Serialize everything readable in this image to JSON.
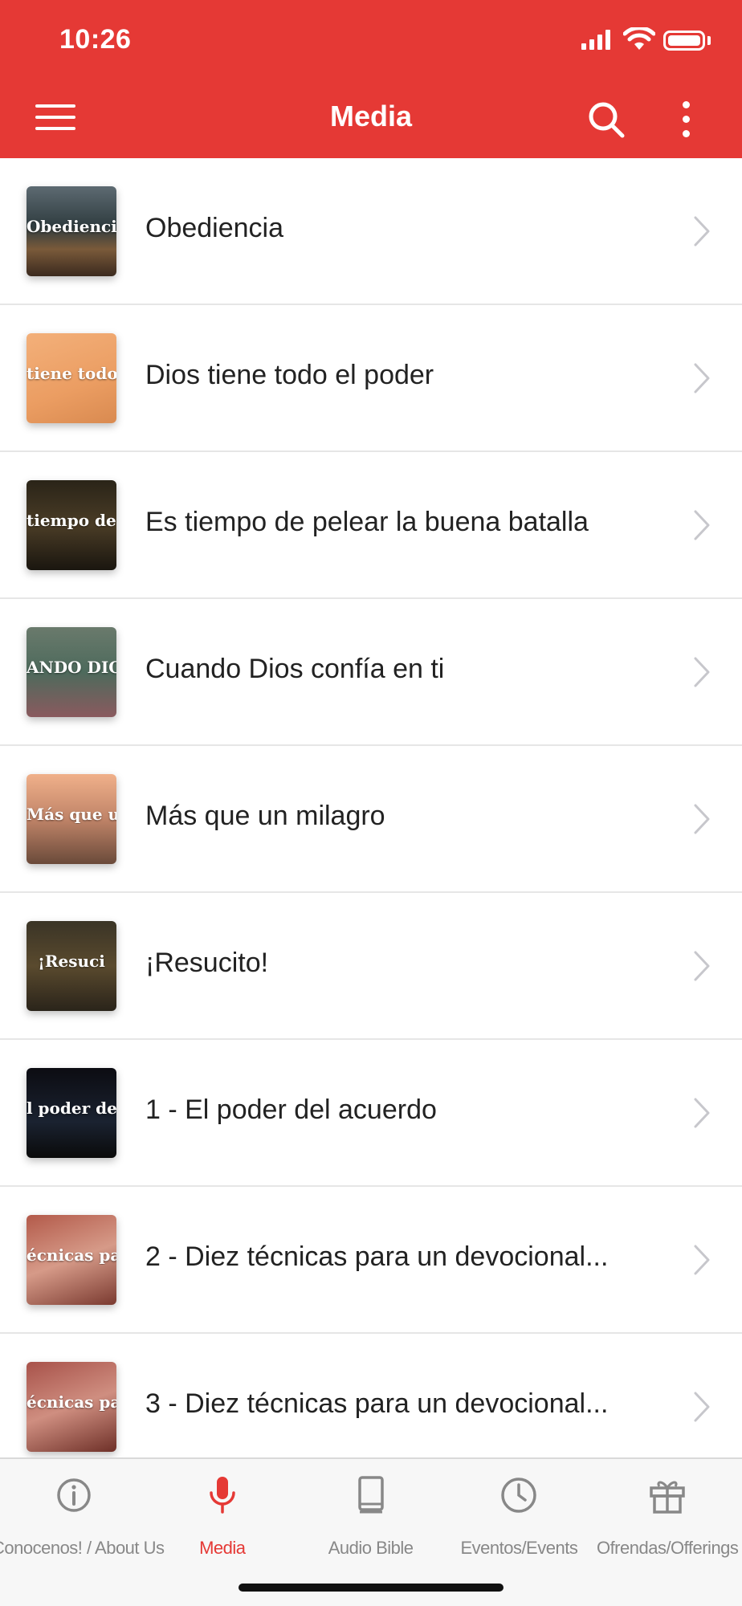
{
  "status_bar": {
    "time": "10:26"
  },
  "header": {
    "title": "Media"
  },
  "colors": {
    "accent": "#e53935",
    "inactive": "#888888"
  },
  "items": [
    {
      "label": "Obediencia",
      "thumb_text": "Obediencia",
      "thumb_bg": "linear-gradient(180deg,#5d6a72 0%,#2f3c3f 45%,#7a5a3a 70%,#3b2a1e 100%)"
    },
    {
      "label": "Dios tiene todo el poder",
      "thumb_text": "tiene todo",
      "thumb_bg": "linear-gradient(160deg,#f3b07a 0%,#eb9d62 60%,#d98a50 100%)"
    },
    {
      "label": "Es tiempo de pelear la buena batalla",
      "thumb_text": "tiempo de pelear",
      "thumb_bg": "linear-gradient(180deg,#2a2418 0%,#4a3c26 50%,#1a160f 100%)"
    },
    {
      "label": "Cuando Dios confía en ti",
      "thumb_text": "ANDO DIOS CONFÍA",
      "thumb_bg": "linear-gradient(180deg,#6a7a6c 0%,#4d6a5c 50%,#8a5a5e 100%)"
    },
    {
      "label": "Más que un milagro",
      "thumb_text": "Más que un milagro",
      "thumb_bg": "linear-gradient(180deg,#f0b08a 0%,#c08468 50%,#6a4a3a 100%)"
    },
    {
      "label": "¡Resucito!",
      "thumb_text": "¡Resuci",
      "thumb_bg": "linear-gradient(180deg,#3a3426 0%,#5a4a2e 50%,#2a241a 100%)"
    },
    {
      "label": "1 - El poder del acuerdo",
      "thumb_text": "l poder del acuerd",
      "thumb_bg": "linear-gradient(180deg,#0c0c12 0%,#1a2230 60%,#0a0a0a 100%)"
    },
    {
      "label": "2 - Diez técnicas para un devocional...",
      "thumb_text": "écnicas para un",
      "thumb_bg": "linear-gradient(160deg,#b35a4a 0%,#d69a88 50%,#7a3a30 100%)"
    },
    {
      "label": "3 - Diez técnicas para un devocional...",
      "thumb_text": "écnicas para un",
      "thumb_bg": "linear-gradient(160deg,#a8524a 0%,#cf8e80 50%,#6e3028 100%)"
    }
  ],
  "tabs": [
    {
      "label": "Conocenos! / About Us",
      "icon": "info-icon",
      "active": false
    },
    {
      "label": "Media",
      "icon": "microphone-icon",
      "active": true
    },
    {
      "label": "Audio Bible",
      "icon": "book-icon",
      "active": false
    },
    {
      "label": "Eventos/Events",
      "icon": "clock-icon",
      "active": false
    },
    {
      "label": "Ofrendas/Offerings",
      "icon": "gift-icon",
      "active": false
    }
  ]
}
